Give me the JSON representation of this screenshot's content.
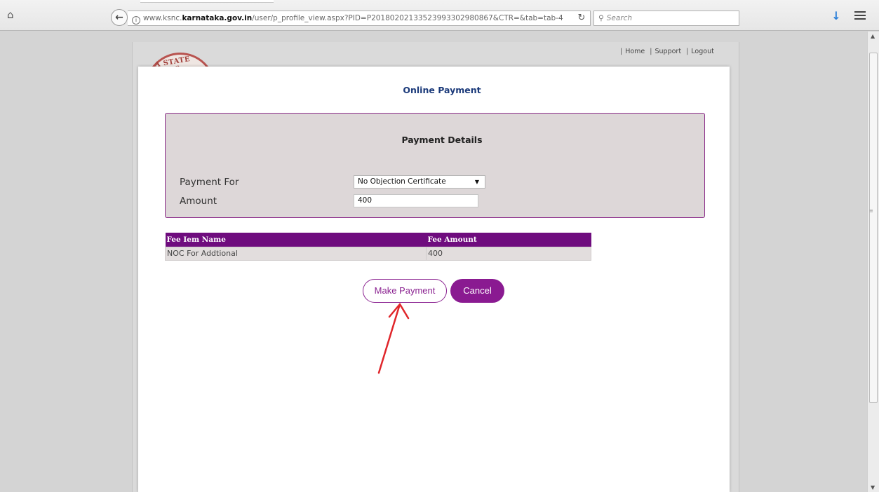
{
  "browser": {
    "url_prefix": "www.ksnc.",
    "url_host": "karnataka.gov.in",
    "url_path": "/user/p_profile_view.aspx?PID=P20180202133523993302980867&CTR=&tab=tab-4",
    "search_placeholder": "Search"
  },
  "site": {
    "logo_text": "A STATE NURS",
    "links": [
      "Home",
      "Support",
      "Logout"
    ]
  },
  "page": {
    "title": "Online Payment",
    "details_title": "Payment Details",
    "payment_for_label": "Payment For",
    "payment_for_value": "No Objection Certificate",
    "amount_label": "Amount",
    "amount_value": "400"
  },
  "fees_table": {
    "headers": [
      "Fee Iem Name",
      "Fee Amount"
    ],
    "rows": [
      [
        "NOC For Addtional",
        "400"
      ]
    ]
  },
  "buttons": {
    "make_payment": "Make Payment",
    "cancel": "Cancel"
  },
  "colors": {
    "accent": "#8a1a91",
    "table_header": "#6f0c7e",
    "annotation_arrow": "#e0262b"
  }
}
